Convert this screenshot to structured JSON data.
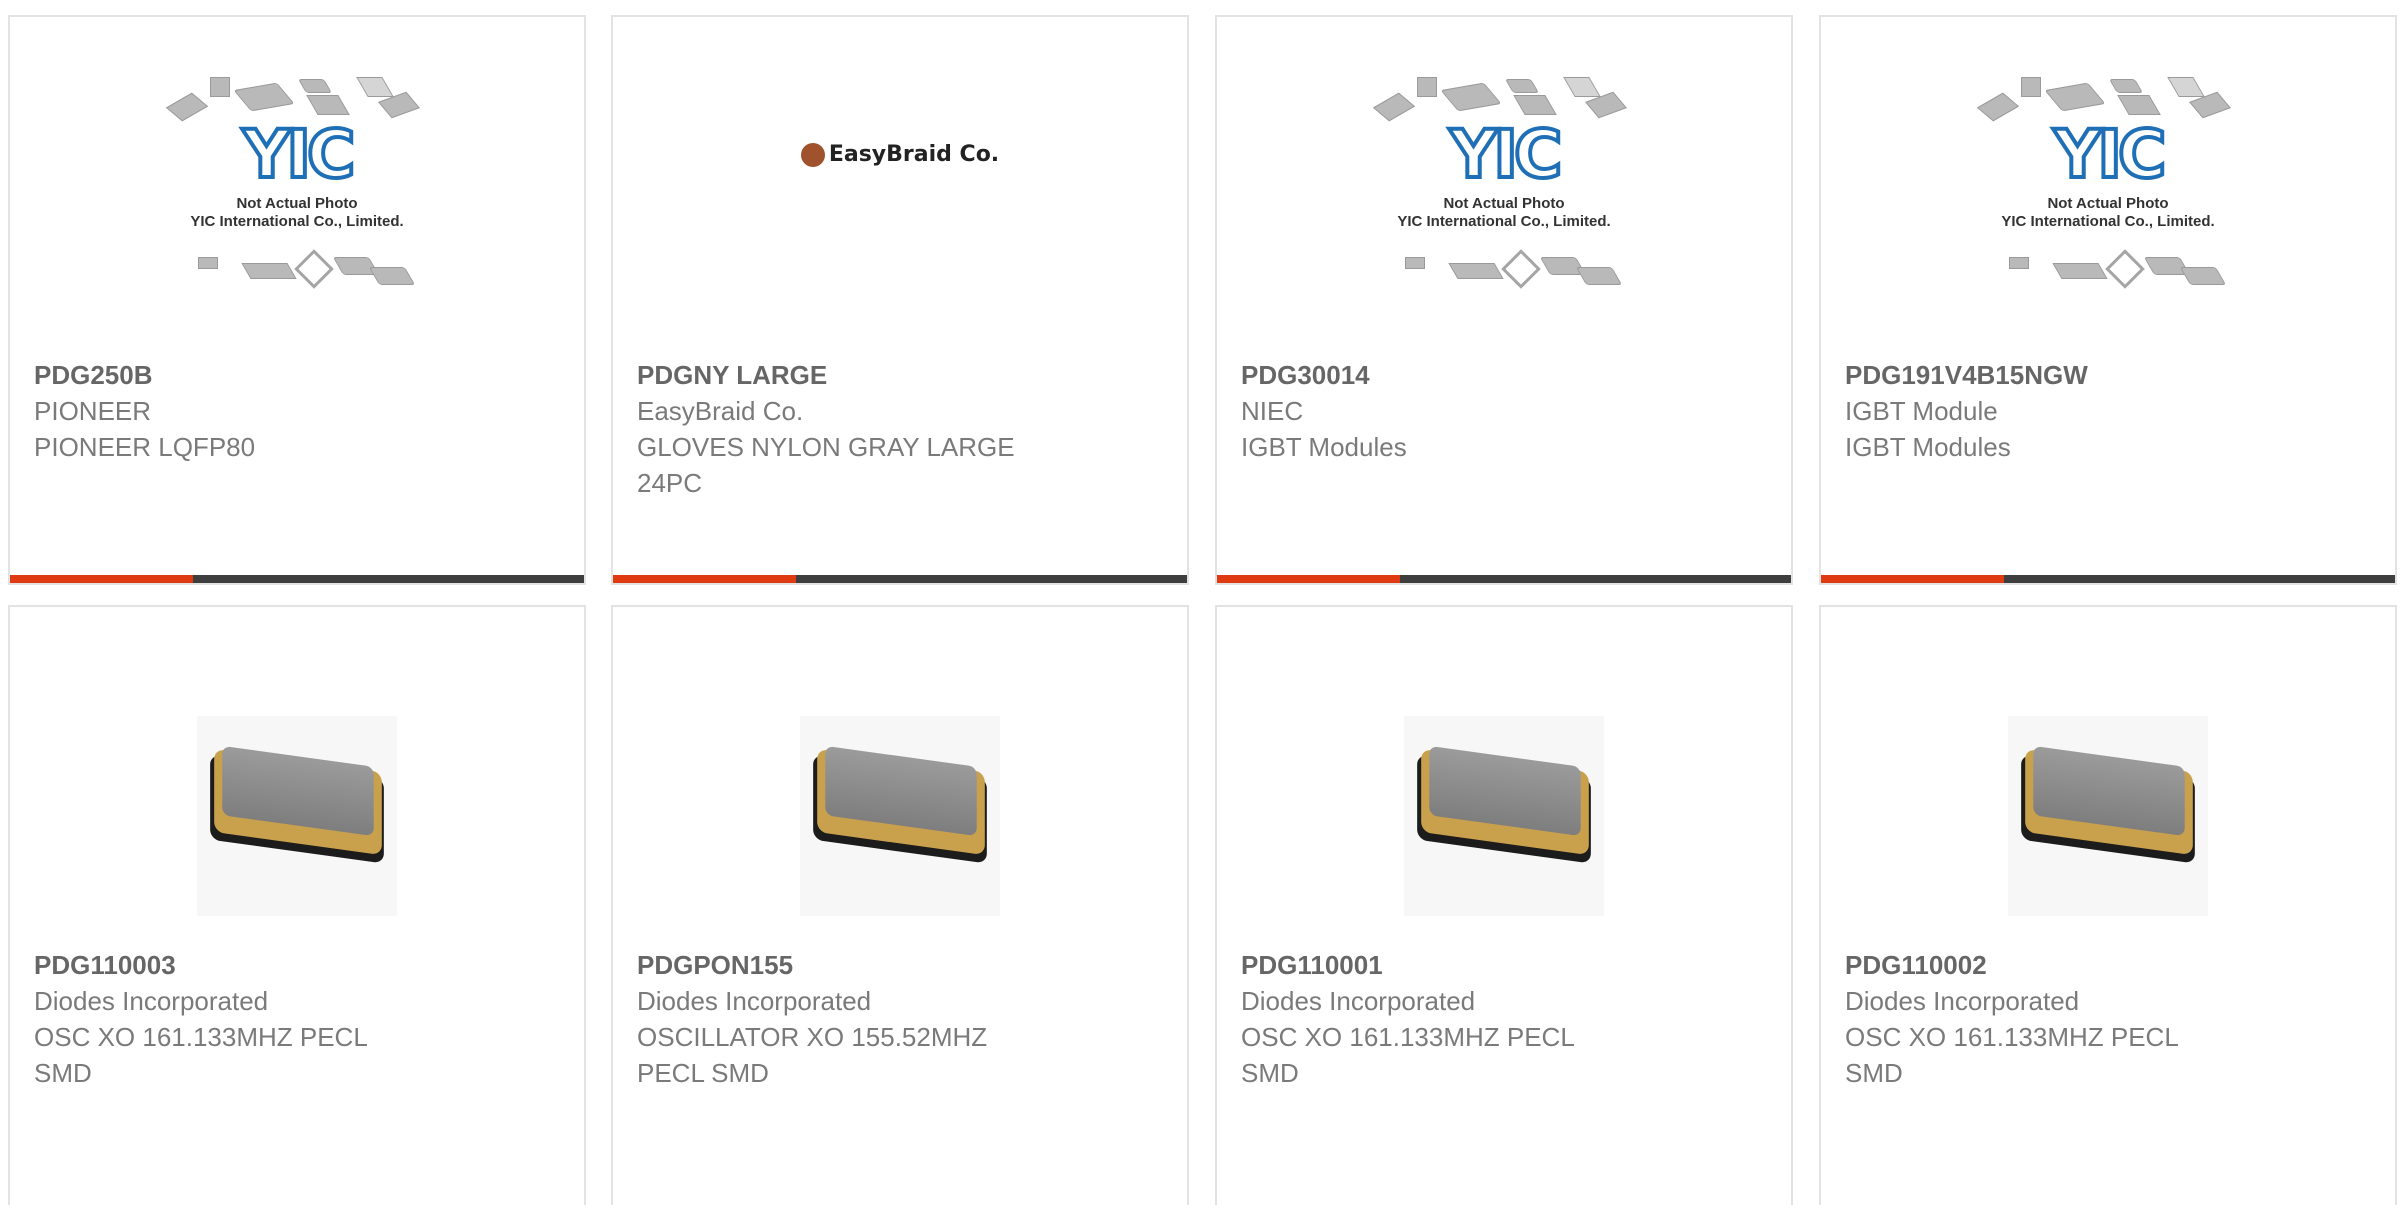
{
  "products": [
    {
      "part": "PDG250B",
      "maker": "PIONEER",
      "desc": "PIONEER LQFP80",
      "image": "yic-not-actual-photo",
      "image_caption": [
        "Not Actual Photo",
        "YIC International Co., Limited."
      ]
    },
    {
      "part": "PDGNY LARGE",
      "maker": "EasyBraid Co.",
      "desc": "GLOVES NYLON GRAY LARGE 24PC",
      "image": "easybraid-logo",
      "image_caption": [
        "EasyBraid Co."
      ]
    },
    {
      "part": "PDG30014",
      "maker": "NIEC",
      "desc": "IGBT Modules",
      "image": "yic-not-actual-photo",
      "image_caption": [
        "Not Actual Photo",
        "YIC International Co., Limited."
      ]
    },
    {
      "part": "PDG191V4B15NGW",
      "maker": "IGBT Module",
      "desc": "IGBT Modules",
      "image": "yic-not-actual-photo",
      "image_caption": [
        "Not Actual Photo",
        "YIC International Co., Limited."
      ]
    },
    {
      "part": "PDG110003",
      "maker": "Diodes Incorporated",
      "desc": "OSC XO 161.133MHZ PECL SMD",
      "image": "oscillator-photo"
    },
    {
      "part": "PDGPON155",
      "maker": "Diodes Incorporated",
      "desc": "OSCILLATOR XO 155.52MHZ PECL SMD",
      "image": "oscillator-photo"
    },
    {
      "part": "PDG110001",
      "maker": "Diodes Incorporated",
      "desc": "OSC XO 161.133MHZ PECL SMD",
      "image": "oscillator-photo"
    },
    {
      "part": "PDG110002",
      "maker": "Diodes Incorporated",
      "desc": "OSC XO 161.133MHZ PECL SMD",
      "image": "oscillator-photo"
    }
  ],
  "colors": {
    "accent": "#e03a12",
    "bar": "#3e3e3e",
    "text": "#7a7a7a",
    "part": "#666666",
    "border": "#e3e3e3"
  }
}
